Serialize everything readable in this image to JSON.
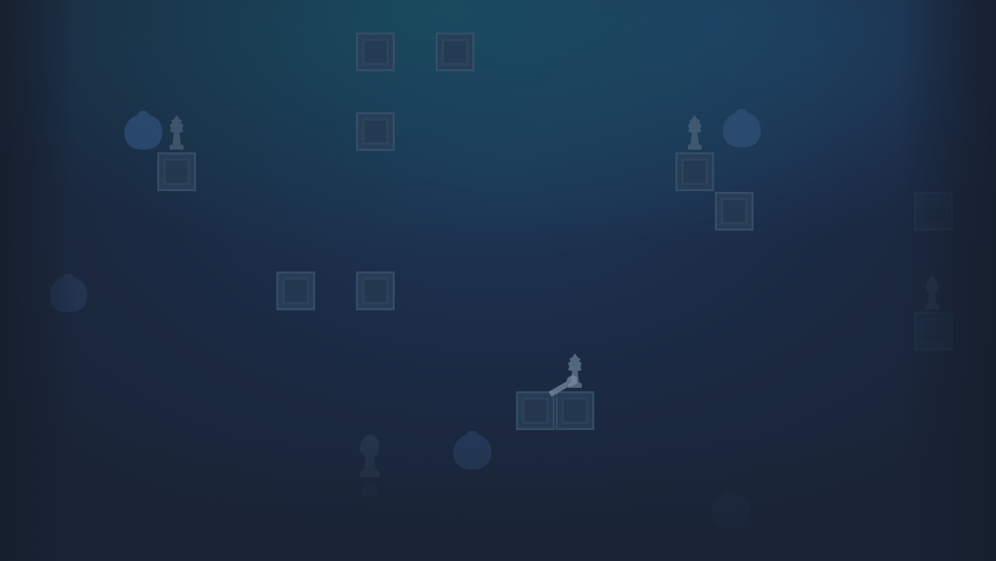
{
  "board": {
    "theme_colors": {
      "background_top": "#1d3a55",
      "background_bottom": "#1b2538",
      "tile_border": "#39516a",
      "tile_fill": "#2a3f58",
      "piece_fill": "#4a6078",
      "bulb_fill": "#2f4a6e"
    },
    "tiles": [
      {
        "name": "crate"
      },
      {
        "name": "crate"
      },
      {
        "name": "crate"
      },
      {
        "name": "crate"
      },
      {
        "name": "crate"
      },
      {
        "name": "crate"
      },
      {
        "name": "crate"
      },
      {
        "name": "crate"
      },
      {
        "name": "crate"
      },
      {
        "name": "crate"
      },
      {
        "name": "crate"
      },
      {
        "name": "crate"
      }
    ],
    "pieces": [
      {
        "kind": "bishop-icon"
      },
      {
        "kind": "bishop-icon"
      },
      {
        "kind": "bishop-icon"
      },
      {
        "kind": "bishop-icon"
      },
      {
        "kind": "knight-icon"
      },
      {
        "kind": "pawn-icon"
      }
    ],
    "orbs": [
      {
        "kind": "bulb-icon"
      },
      {
        "kind": "bulb-icon"
      },
      {
        "kind": "bulb-icon"
      },
      {
        "kind": "bulb-icon"
      },
      {
        "kind": "bulb-icon"
      }
    ]
  }
}
